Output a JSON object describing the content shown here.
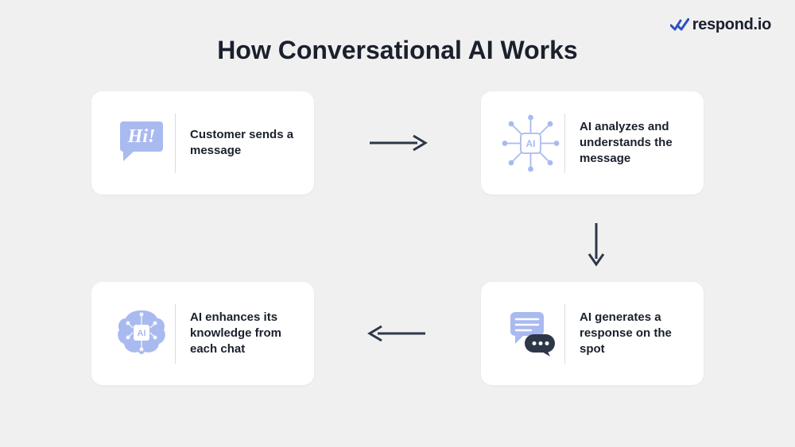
{
  "brand": {
    "text": "respond.io",
    "icon_name": "brand-checkmark-icon",
    "color": "#2950C5"
  },
  "title": "How Conversational AI Works",
  "colors": {
    "icon_blue": "#A9BAF0",
    "text_dark": "#1a202c",
    "arrow": "#2d3748",
    "card_bg": "#ffffff",
    "page_bg": "#f0f0f0"
  },
  "steps": [
    {
      "order": 1,
      "icon": "speech-bubble-hi-icon",
      "label": "Customer sends a message"
    },
    {
      "order": 2,
      "icon": "ai-chip-icon",
      "label": "AI analyzes and understands the message"
    },
    {
      "order": 3,
      "icon": "chat-bubbles-icon",
      "label": "AI generates a response on the spot"
    },
    {
      "order": 4,
      "icon": "ai-brain-icon",
      "label": "AI enhances its knowledge from each chat"
    }
  ],
  "arrows": [
    {
      "from": 1,
      "to": 2,
      "direction": "right"
    },
    {
      "from": 2,
      "to": 3,
      "direction": "down"
    },
    {
      "from": 3,
      "to": 4,
      "direction": "left"
    }
  ]
}
